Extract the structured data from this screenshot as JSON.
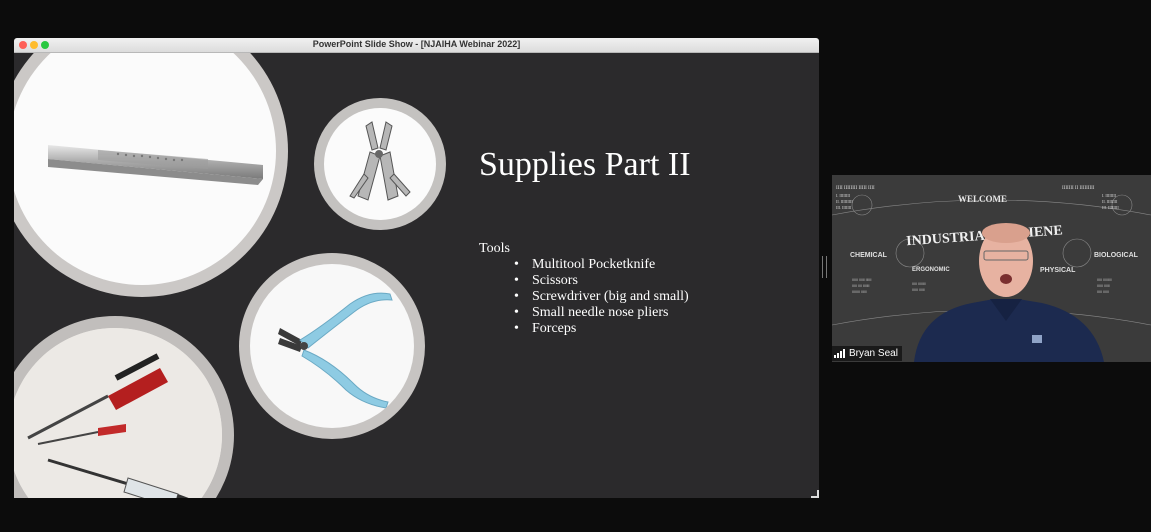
{
  "window": {
    "title": "PowerPoint Slide Show - [NJAIHA Webinar 2022]"
  },
  "slide": {
    "title": "Supplies Part II",
    "list_heading": "Tools",
    "items": [
      "Multitool Pocketknife",
      "Scissors",
      "Screwdriver (big and small)",
      "Small needle nose pliers",
      "Forceps"
    ],
    "bullet": "•"
  },
  "participant": {
    "name": "Bryan Seal",
    "shirt_color": "#1c2a4f",
    "skin_color": "#e7b2a1"
  },
  "background_poster": {
    "banner": "WELCOME",
    "headline": "INDUSTRIAL HYGIENE",
    "labels": [
      "CHEMICAL",
      "ERGONOMIC",
      "PHYSICAL",
      "BIOLOGICAL"
    ]
  },
  "colors": {
    "slide_bg": "#2b2a2c",
    "pliers_handle": "#8ecbe3",
    "screwdriver_handle": "#b41f1f"
  }
}
